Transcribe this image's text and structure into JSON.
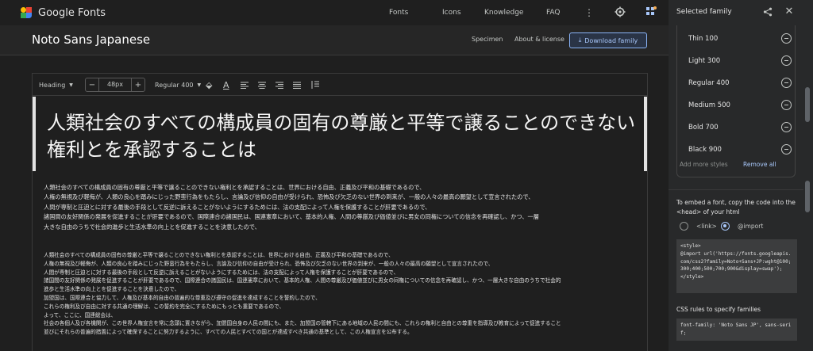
{
  "colors": {
    "accent": "#a8c7fa",
    "background": "#1f1f1f",
    "panel": "#28292a",
    "code_bg": "#3c3d3e"
  },
  "header": {
    "app_title": "Google Fonts",
    "nav": [
      "Fonts",
      "Icons",
      "Knowledge",
      "FAQ"
    ],
    "icons": [
      "more-vert-icon",
      "settings-icon",
      "selected-families-icon"
    ]
  },
  "family": {
    "name": "Noto Sans Japanese",
    "links": [
      "Specimen",
      "About & license"
    ],
    "download_label": "Download family"
  },
  "toolbar": {
    "style_select": "Heading",
    "size_minus": "−",
    "size_value": "48px",
    "size_plus": "+",
    "weight_select": "Regular 400"
  },
  "editor": {
    "heading": "人類社会のすべての構成員の固有の尊厳と平等で譲ることのできない権利とを承認することは",
    "paragraph1": [
      "人類社会のすべての構成員の固有の尊厳と平等で譲ることのできない権利とを承認することは、世界における自由、正義及び平和の基礎であるので、",
      "人権の無視及び軽侮が、人類の良心を踏みにじった野蛮行為をもたらし、言論及び信仰の自由が受けられ、恐怖及び欠乏のない世界の到来が、一般の人々の最高の願望として宣言されたので、",
      "人間が専制と圧迫とに対する最後の手段として反逆に訴えることがないようにするためには、法の支配によって人権を保護することが肝要であるので、",
      "諸国間の友好関係の発展を促進することが肝要であるので、国際連合の諸国民は、国連憲章において、基本的人権、人間の尊厳及び価値並びに男女の同権についての信念を再確認し、かつ、一層",
      "大きな自由のうちで社会的進歩と生活水準の向上とを促進することを決意したので、"
    ],
    "paragraph2": [
      "人類社会のすべての構成員の固有の尊厳と平等で譲ることのできない権利とを承認することは、世界における自由、正義及び平和の基礎であるので、",
      "人権の無視及び軽侮が、人類の良心を踏みにじった野蛮行為をもたらし、言論及び信仰の自由が受けられ、恐怖及び欠乏のない世界の到来が、一般の人々の最高の願望として宣言されたので、",
      "人間が専制と圧迫とに対する最後の手段として反逆に訴えることがないようにするためには、法の支配によって人権を保護することが肝要であるので、",
      "諸国間の友好関係の発展を促進することが肝要であるので、国際連合の諸国民は、国連憲章において、基本的人権、人間の尊厳及び価値並びに男女の同権についての信念を再確認し、かつ、一層大きな自由のうちで社会的",
      "進歩と生活水準の向上とを促進することを決意したので、",
      "加盟国は、国際連合と協力して、人権及び基本的自由の普遍的な尊重及び遵守の促進を達成することを誓約したので、",
      "これらの権利及び自由に対する共通の理解は、この誓約を完全にするためにもっとも重要であるので、",
      "よって、ここに、国連総会は、",
      "社会の各個人及び各機関が、この世界人権宣言を常に念頭に置きながら、加盟国自身の人民の間にも、また、加盟国の管轄下にある地域の人民の間にも、これらの権利と自由との尊重を指導及び教育によって促進すること",
      "並びにそれらの普遍的措置によって確保することに努力するように、すべての人民とすべての国とが達成すべき共通の基準として、この人権宣言を公布する。"
    ]
  },
  "panel": {
    "title": "Selected family",
    "styles": [
      "Thin 100",
      "Light 300",
      "Regular 400",
      "Medium 500",
      "Bold 700",
      "Black 900"
    ],
    "add_more": "Add more styles",
    "remove_all": "Remove all",
    "embed_desc": "To embed a font, copy the code into the <head> of your html",
    "radio_link": "<link>",
    "radio_import": "@import",
    "import_code": "<style>\n@import url('https://fonts.googleapis.com/css2?family=Noto+Sans+JP:wght@100;300;400;500;700;900&display=swap');\n</style>",
    "css_label": "CSS rules to specify families",
    "css_code": "font-family: 'Noto Sans JP', sans-serif;"
  }
}
